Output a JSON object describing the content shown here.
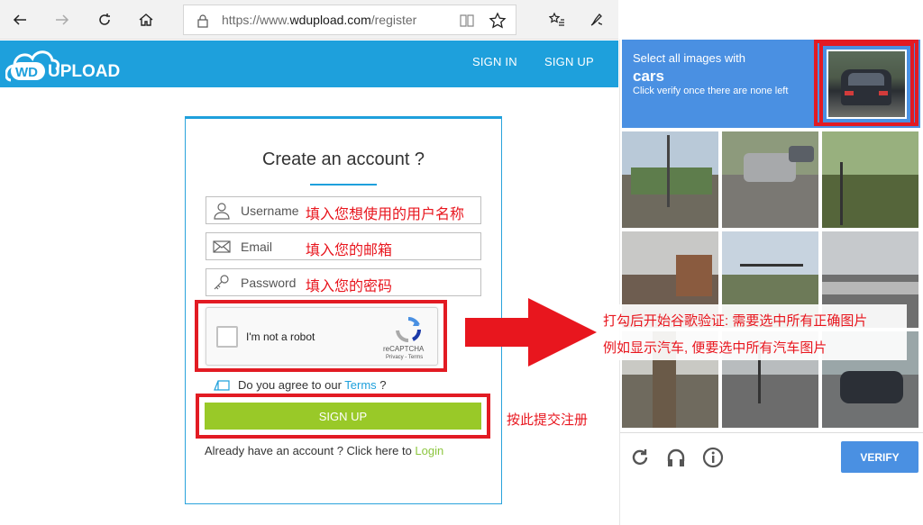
{
  "browser": {
    "url_prefix": "https://www.",
    "url_domain": "wdupload.com",
    "url_path": "/register",
    "icons": [
      "back-icon",
      "forward-icon",
      "refresh-icon",
      "home-icon",
      "lock-icon",
      "reader-view-icon",
      "favorite-star-icon",
      "favorites-list-icon",
      "pen-icon"
    ]
  },
  "site": {
    "logo_text": "WDUPLOAD",
    "nav": {
      "sign_in": "SIGN IN",
      "sign_up": "SIGN UP"
    },
    "brand_color": "#1ea0dc"
  },
  "form": {
    "title": "Create an account ?",
    "username_placeholder": "Username",
    "email_placeholder": "Email",
    "password_placeholder": "Password",
    "agree_prefix": "Do you agree to our ",
    "agree_link": "Terms",
    "agree_suffix": " ?",
    "signup_label": "SIGN UP",
    "login_prefix": "Already have an account ? Click here to ",
    "login_link": "Login"
  },
  "captcha": {
    "label": "I'm not a robot",
    "brand": "reCAPTCHA",
    "terms": "Privacy - Terms"
  },
  "annotations": {
    "username": "填入您想使用的用户名称",
    "email": "填入您的邮箱",
    "password": "填入您的密码",
    "submit": "按此提交注册",
    "captcha_line1": "打勾后开始谷歌验证: 需要选中所有正确图片",
    "captcha_line2": "例如显示汽车, 便要选中所有汽车图片",
    "highlight_color": "#e21b23"
  },
  "challenge": {
    "line1": "Select all images with",
    "target": "cars",
    "line3": "Click verify once there are none left",
    "verify_label": "VERIFY",
    "header_color": "#4a90e2",
    "footer_icons": [
      "reload-icon",
      "audio-headphones-icon",
      "info-icon"
    ]
  }
}
